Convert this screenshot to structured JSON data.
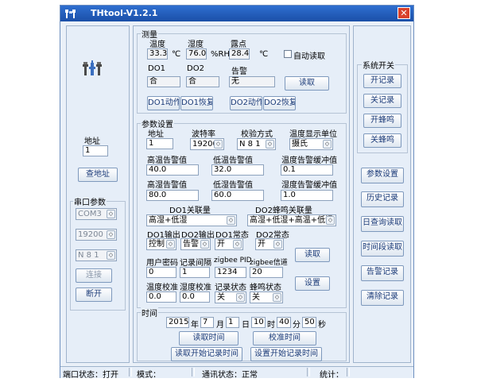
{
  "window": {
    "title": "THtool-V1.2.1"
  },
  "left": {
    "address_label": "地址",
    "address_value": "1",
    "find_address_button": "查地址",
    "serial_group_label": "串口参数",
    "port_value": "COM3",
    "baud_value": "19200",
    "parity_value": "N 8 1",
    "connect_button": "连接",
    "disconnect_button": "断开"
  },
  "measure": {
    "group_label": "测量",
    "temp_label": "温度",
    "temp_value": "33.3",
    "temp_unit": "℃",
    "humid_label": "湿度",
    "humid_value": "76.0",
    "humid_unit": "%RH",
    "dew_label": "露点",
    "dew_value": "28.4",
    "dew_unit": "℃",
    "auto_read_label": "自动读取",
    "do1_label": "DO1",
    "do1_value": "合",
    "do2_label": "DO2",
    "do2_value": "合",
    "alarm_label": "告警",
    "alarm_value": "无",
    "read_button": "读取",
    "do1_action_button": "DO1动作",
    "do1_reset_button": "DO1恢复",
    "do2_action_button": "DO2动作",
    "do2_reset_button": "DO2恢复"
  },
  "params": {
    "group_label": "参数设置",
    "address_label": "地址",
    "address_value": "1",
    "baud_label": "波特率",
    "baud_value": "19200",
    "parity_label": "校验方式",
    "parity_value": "N 8 1",
    "temp_unit_label": "温度显示单位",
    "temp_unit_value": "摄氏",
    "high_temp_label": "高温告警值",
    "high_temp_value": "40.0",
    "low_temp_label": "低温告警值",
    "low_temp_value": "32.0",
    "temp_buffer_label": "温度告警缓冲值",
    "temp_buffer_value": "0.1",
    "high_humid_label": "高湿告警值",
    "high_humid_value": "80.0",
    "low_humid_label": "低湿告警值",
    "low_humid_value": "60.0",
    "humid_buffer_label": "湿度告警缓冲值",
    "humid_buffer_value": "1.0",
    "do1_link_label": "DO1关联量",
    "do1_link_value": "高湿+低湿",
    "do2_link_label": "DO2蜂鸣关联量",
    "do2_link_value": "高湿+低湿+高温+低温",
    "do1_output_label": "DO1输出",
    "do1_output_value": "控制",
    "do2_output_label": "DO2输出",
    "do2_output_value": "告警",
    "do1_normal_label": "DO1常态",
    "do1_normal_value": "开",
    "do2_normal_label": "DO2常态",
    "do2_normal_value": "开",
    "read_button": "读取",
    "password_label": "用户密码",
    "password_value": "0",
    "record_interval_label": "记录间隔",
    "record_interval_value": "1",
    "zigbee_pid_label": "zigbee PID",
    "zigbee_pid_value": "1234",
    "zigbee_channel_label": "zigbee信道",
    "zigbee_channel_value": "20",
    "set_button": "设置",
    "temp_cal_label": "温度校准",
    "temp_cal_value": "0.0",
    "humid_cal_label": "湿度校准",
    "humid_cal_value": "0.0",
    "record_state_label": "记录状态",
    "record_state_value": "关",
    "buzzer_state_label": "蜂鸣状态",
    "buzzer_state_value": "关"
  },
  "time": {
    "group_label": "时间",
    "year": "2015",
    "year_unit": "年",
    "month": "7",
    "month_unit": "月",
    "day": "1",
    "day_unit": "日",
    "hour": "10",
    "hour_unit": "时",
    "minute": "40",
    "minute_unit": "分",
    "second": "50",
    "second_unit": "秒",
    "read_time_button": "读取时间",
    "calibrate_time_button": "校准时间",
    "read_record_start_button": "读取开始记录时间",
    "set_record_start_button": "设置开始记录时间"
  },
  "right": {
    "system_switch_label": "系统开关",
    "start_record_button": "开记录",
    "stop_record_button": "关记录",
    "buzzer_on_button": "开蜂鸣",
    "buzzer_off_button": "关蜂鸣",
    "param_settings_button": "参数设置",
    "history_button": "历史记录",
    "daily_query_button": "日查询读取",
    "period_read_button": "时间段读取",
    "alarm_record_button": "告警记录",
    "clear_record_button": "清除记录"
  },
  "statusbar": {
    "port_status": "端口状态：打开",
    "mode": "模式：",
    "comm_status": "通讯状态：正常",
    "stats": "统计："
  }
}
